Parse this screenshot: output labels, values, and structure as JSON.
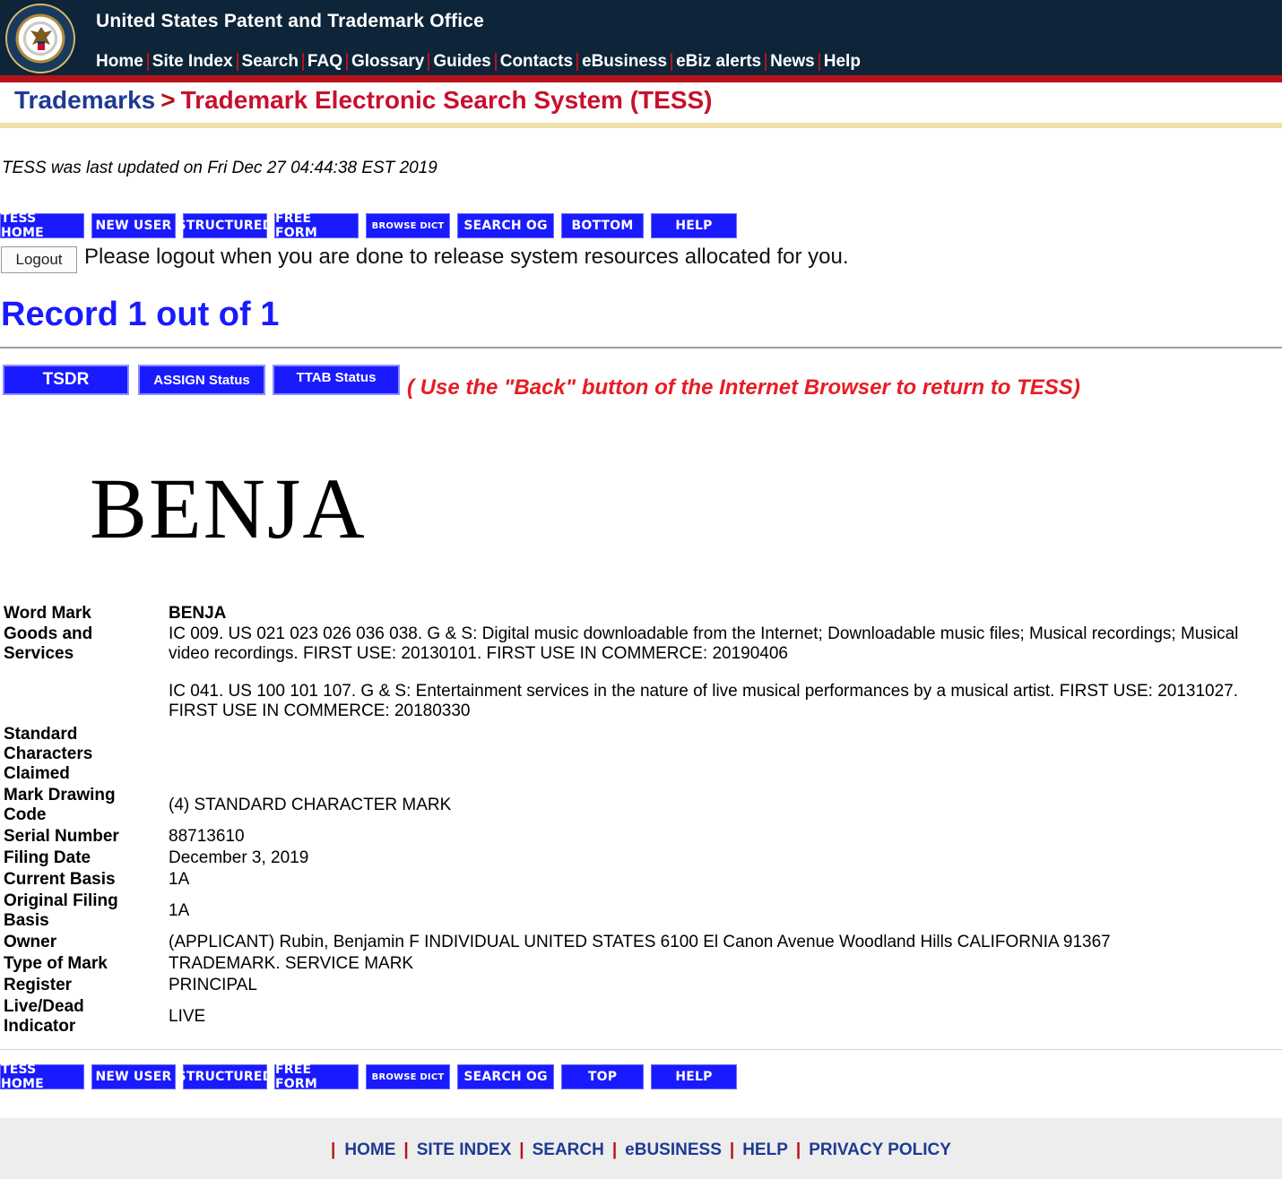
{
  "header": {
    "agency": "United States Patent and Trademark Office",
    "nav": [
      "Home",
      "Site Index",
      "Search",
      "FAQ",
      "Glossary",
      "Guides",
      "Contacts",
      "eBusiness",
      "eBiz alerts",
      "News",
      "Help"
    ]
  },
  "breadcrumb": {
    "section": "Trademarks",
    "separator": ">",
    "page": "Trademark Electronic Search System (TESS)"
  },
  "updated_text": "TESS was last updated on Fri Dec 27 04:44:38 EST 2019",
  "toolbar_top": [
    "TESS Home",
    "New User",
    "Structured",
    "Free Form",
    "Browse Dict",
    "SEARCH OG",
    "Bottom",
    "HELP"
  ],
  "logout": {
    "button": "Logout",
    "message": "Please logout when you are done to release system resources allocated for you."
  },
  "record_title": "Record 1 out of 1",
  "status_buttons": [
    "TSDR",
    "ASSIGN Status",
    "TTAB Status"
  ],
  "back_note": "( Use the \"Back\" button of the Internet Browser to return to TESS)",
  "mark_text": "BENJA",
  "details": {
    "word_mark_label": "Word Mark",
    "word_mark": "BENJA",
    "goods_label_1": "Goods and",
    "goods_label_2": "Services",
    "goods_1": "IC 009. US 021 023 026 036 038. G & S: Digital music downloadable from the Internet; Downloadable music files; Musical recordings; Musical video recordings. FIRST USE: 20130101. FIRST USE IN COMMERCE: 20190406",
    "goods_2": "IC 041. US 100 101 107. G & S: Entertainment services in the nature of live musical performances by a musical artist. FIRST USE: 20131027. FIRST USE IN COMMERCE: 20180330",
    "std_chars_label_1": "Standard",
    "std_chars_label_2": "Characters",
    "std_chars_label_3": "Claimed",
    "drawing_code_label_1": "Mark Drawing",
    "drawing_code_label_2": "Code",
    "drawing_code": "(4) STANDARD CHARACTER MARK",
    "serial_label": "Serial Number",
    "serial": "88713610",
    "filing_date_label": "Filing Date",
    "filing_date": "December 3, 2019",
    "current_basis_label": "Current Basis",
    "current_basis": "1A",
    "original_basis_label_1": "Original Filing",
    "original_basis_label_2": "Basis",
    "original_basis": "1A",
    "owner_label": "Owner",
    "owner": "(APPLICANT) Rubin, Benjamin F INDIVIDUAL UNITED STATES 6100 El Canon Avenue Woodland Hills CALIFORNIA 91367",
    "type_label": "Type of Mark",
    "type": "TRADEMARK. SERVICE MARK",
    "register_label": "Register",
    "register": "PRINCIPAL",
    "live_label_1": "Live/Dead",
    "live_label_2": "Indicator",
    "live": "LIVE"
  },
  "toolbar_bottom": [
    "TESS Home",
    "New User",
    "Structured",
    "Free Form",
    "Browse Dict",
    "SEARCH OG",
    "Top",
    "HELP"
  ],
  "footer": [
    "HOME",
    "SITE INDEX",
    "SEARCH",
    "eBUSINESS",
    "HELP",
    "PRIVACY POLICY"
  ],
  "colors": {
    "banner": "#0d2439",
    "accent_red": "#b5121b",
    "button_blue": "#1a1aff",
    "title_blue": "#1f3a93",
    "note_red": "#e81c24"
  }
}
